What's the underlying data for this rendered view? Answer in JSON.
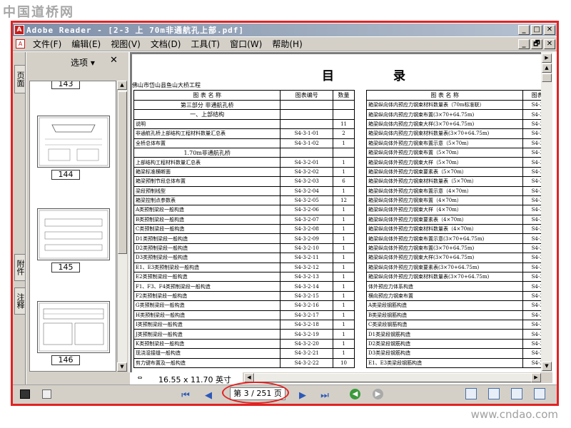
{
  "watermark_top": "中国道桥网",
  "watermark_bottom": "www.cndao.com",
  "window": {
    "app_icon": "adobe-reader-icon",
    "title": "Adobe Reader - [2-3 上 70m非通航孔上部.pdf]",
    "min": "_",
    "max": "□",
    "close": "✕",
    "restore": "🗗"
  },
  "menu": [
    "文件(F)",
    "编辑(E)",
    "视图(V)",
    "文档(D)",
    "工具(T)",
    "窗口(W)",
    "帮助(H)"
  ],
  "side_tabs": {
    "pages": "页面",
    "attachments": "附件",
    "comments": "注释"
  },
  "side_panel": {
    "options_label": "选项 ▾",
    "close": "✕",
    "thumb_partial": "143",
    "thumbnails": [
      "144",
      "145",
      "146"
    ]
  },
  "document": {
    "toc_title_1": "目",
    "toc_title_2": "录",
    "subtitle": "佛山市岱山县鱼山大桥工程",
    "left_table": {
      "headers": [
        "图  表  名  称",
        "图表编号",
        "数量"
      ],
      "rows": [
        [
          "第三部分 非通航孔桥",
          "",
          ""
        ],
        [
          "一、上部结构",
          "",
          ""
        ],
        [
          "说明",
          "",
          "11"
        ],
        [
          "非通航孔桥上部结构工程材料数量汇总表",
          "S4-3-1-01",
          "2"
        ],
        [
          "全桥总体布置",
          "S4-3-1-02",
          "1"
        ],
        [
          "1.70m非通航孔桥",
          "",
          ""
        ],
        [
          "上部结构工程材料数量汇总表",
          "S4-3-2-01",
          "1"
        ],
        [
          "箱梁标准横断面",
          "S4-3-2-02",
          "1"
        ],
        [
          "箱梁预制节段总体布置",
          "S4-3-2-03",
          "6"
        ],
        [
          "梁段预制线型",
          "S4-3-2-04",
          "1"
        ],
        [
          "箱梁控制点参数表",
          "S4-3-2-05",
          "12"
        ],
        [
          "A类预制梁段一般构造",
          "S4-3-2-06",
          "1"
        ],
        [
          "B类预制梁段一般构造",
          "S4-3-2-07",
          "1"
        ],
        [
          "C类预制梁段一般构造",
          "S4-3-2-08",
          "1"
        ],
        [
          "D1类预制梁段一般构造",
          "S4-3-2-09",
          "1"
        ],
        [
          "D2类预制梁段一般构造",
          "S4-3-2-10",
          "1"
        ],
        [
          "D3类预制梁段一般构造",
          "S4-3-2-11",
          "1"
        ],
        [
          "E1、E3类预制梁段一般构造",
          "S4-3-2-12",
          "1"
        ],
        [
          "E2类预制梁段一般构造",
          "S4-3-2-13",
          "1"
        ],
        [
          "F1、F3、F4类预制梁段一般构造",
          "S4-3-2-14",
          "1"
        ],
        [
          "F2类预制梁段一般构造",
          "S4-3-2-15",
          "1"
        ],
        [
          "G类预制梁段一般构造",
          "S4-3-2-16",
          "1"
        ],
        [
          "H类预制梁段一般构造",
          "S4-3-2-17",
          "1"
        ],
        [
          "I类预制梁段一般构造",
          "S4-3-2-18",
          "1"
        ],
        [
          "J类预制梁段一般构造",
          "S4-3-2-19",
          "1"
        ],
        [
          "K类预制梁段一般构造",
          "S4-3-2-20",
          "1"
        ],
        [
          "现浇湿接缝一般构造",
          "S4-3-2-21",
          "1"
        ],
        [
          "剪力键布置及一般构造",
          "S4-3-2-22",
          "10"
        ]
      ]
    },
    "right_table": {
      "headers": [
        "图  表  名  称",
        "图表"
      ],
      "rows": [
        [
          "箱梁纵向体内预应力钢束材料数量表（70m标准联）",
          "S4-3"
        ],
        [
          "箱梁纵向体内预应力钢束布置(3×70+64.75m)",
          "S4-3"
        ],
        [
          "箱梁纵向体内预应力钢束大样(3×70+64.75m)",
          "S4-3"
        ],
        [
          "箱梁纵向体内预应力钢束材料数量表(3×70+64.75m)",
          "S4-3"
        ],
        [
          "箱梁纵向体外预应力钢束布置示意（5×70m）",
          "S4-3"
        ],
        [
          "箱梁纵向体外预应力钢束布置（5×70m）",
          "S4-3"
        ],
        [
          "箱梁纵向体外预应力钢束大样（5×70m）",
          "S4-3"
        ],
        [
          "箱梁纵向体外预应力钢束要素表（5×70m）",
          "S4-3"
        ],
        [
          "箱梁纵向体外预应力钢束材料数量表（5×70m）",
          "S4-3"
        ],
        [
          "箱梁纵向体外预应力钢束布置示意（4×70m）",
          "S4-3"
        ],
        [
          "箱梁纵向体外预应力钢束布置（4×70m）",
          "S4-3"
        ],
        [
          "箱梁纵向体外预应力钢束大样（4×70m）",
          "S4-3"
        ],
        [
          "箱梁纵向体外预应力钢束要素表（4×70m）",
          "S4-3"
        ],
        [
          "箱梁纵向体外预应力钢束材料数量表（4×70m）",
          "S4-3"
        ],
        [
          "箱梁纵向体外预应力钢束布置示意(3×70+64.75m)",
          "S4-3"
        ],
        [
          "箱梁纵向体外预应力钢束布置(3×70+64.75m)",
          "S4-3"
        ],
        [
          "箱梁纵向体外预应力钢束大样(3×70+64.75m)",
          "S4-3"
        ],
        [
          "箱梁纵向体外预应力钢束要素表(3×70+64.75m)",
          "S4-3"
        ],
        [
          "箱梁纵向体外预应力钢束材料数量表(3×70+64.75m)",
          "S4-3"
        ],
        [
          "体外预应力体系构造",
          "S4-3"
        ],
        [
          "横向预应力钢束布置",
          "S4-3"
        ],
        [
          "A类梁段钢筋构造",
          "S4-3"
        ],
        [
          "B类梁段钢筋构造",
          "S4-3"
        ],
        [
          "C类梁段钢筋构造",
          "S4-3"
        ],
        [
          "D1类梁段钢筋构造",
          "S4-3"
        ],
        [
          "D2类梁段钢筋构造",
          "S4-3"
        ],
        [
          "D3类梁段钢筋构造",
          "S4-3"
        ],
        [
          "E1、E3类梁段钢筋构造",
          "S4-3"
        ]
      ]
    }
  },
  "status": {
    "page_size": "16.55 x 11.70 英寸",
    "page_indicator": "第 3 / 251 页"
  },
  "colors": {
    "highlight_red": "#e22222",
    "chrome_gray": "#d4d0c8",
    "title_blue": "#7f8fa8"
  }
}
